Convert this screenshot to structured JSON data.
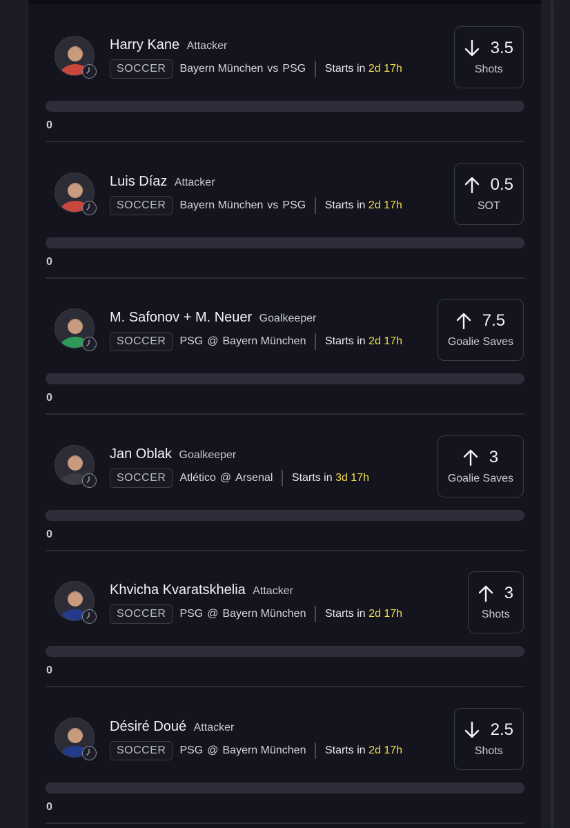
{
  "picks": [
    {
      "name": "Harry Kane",
      "position": "Attacker",
      "sport": "SOCCER",
      "team_a": "Bayern München",
      "sep": "vs",
      "team_b": "PSG",
      "starts_label": "Starts in",
      "starts_time": "2d 17h",
      "direction": "down",
      "value": "3.5",
      "stat": "Shots",
      "progress": 0,
      "count": "0",
      "avatar_color": "#c9473d"
    },
    {
      "name": "Luis Díaz",
      "position": "Attacker",
      "sport": "SOCCER",
      "team_a": "Bayern München",
      "sep": "vs",
      "team_b": "PSG",
      "starts_label": "Starts in",
      "starts_time": "2d 17h",
      "direction": "up",
      "value": "0.5",
      "stat": "SOT",
      "progress": 0,
      "count": "0",
      "avatar_color": "#c9473d"
    },
    {
      "name": "M. Safonov + M. Neuer",
      "position": "Goalkeeper",
      "sport": "SOCCER",
      "team_a": "PSG",
      "sep": "@",
      "team_b": "Bayern München",
      "starts_label": "Starts in",
      "starts_time": "2d 17h",
      "direction": "up",
      "value": "7.5",
      "stat": "Goalie Saves",
      "progress": 0,
      "count": "0",
      "avatar_color": "#2d9a5a"
    },
    {
      "name": "Jan Oblak",
      "position": "Goalkeeper",
      "sport": "SOCCER",
      "team_a": "Atlético",
      "sep": "@",
      "team_b": "Arsenal",
      "starts_label": "Starts in",
      "starts_time": "3d 17h",
      "direction": "up",
      "value": "3",
      "stat": "Goalie Saves",
      "progress": 0,
      "count": "0",
      "avatar_color": "#3a3b44"
    },
    {
      "name": "Khvicha Kvaratskhelia",
      "position": "Attacker",
      "sport": "SOCCER",
      "team_a": "PSG",
      "sep": "@",
      "team_b": "Bayern München",
      "starts_label": "Starts in",
      "starts_time": "2d 17h",
      "direction": "up",
      "value": "3",
      "stat": "Shots",
      "progress": 0,
      "count": "0",
      "avatar_color": "#243a8a"
    },
    {
      "name": "Désiré Doué",
      "position": "Attacker",
      "sport": "SOCCER",
      "team_a": "PSG",
      "sep": "@",
      "team_b": "Bayern München",
      "starts_label": "Starts in",
      "starts_time": "2d 17h",
      "direction": "down",
      "value": "2.5",
      "stat": "Shots",
      "progress": 0,
      "count": "0",
      "avatar_color": "#243a8a"
    }
  ],
  "colors": {
    "accent_time": "#f5df4d",
    "background": "#13141d"
  },
  "icons": {
    "avatar": "player-photo",
    "clock": "clock-icon",
    "up": "arrow-up-icon",
    "down": "arrow-down-icon"
  }
}
